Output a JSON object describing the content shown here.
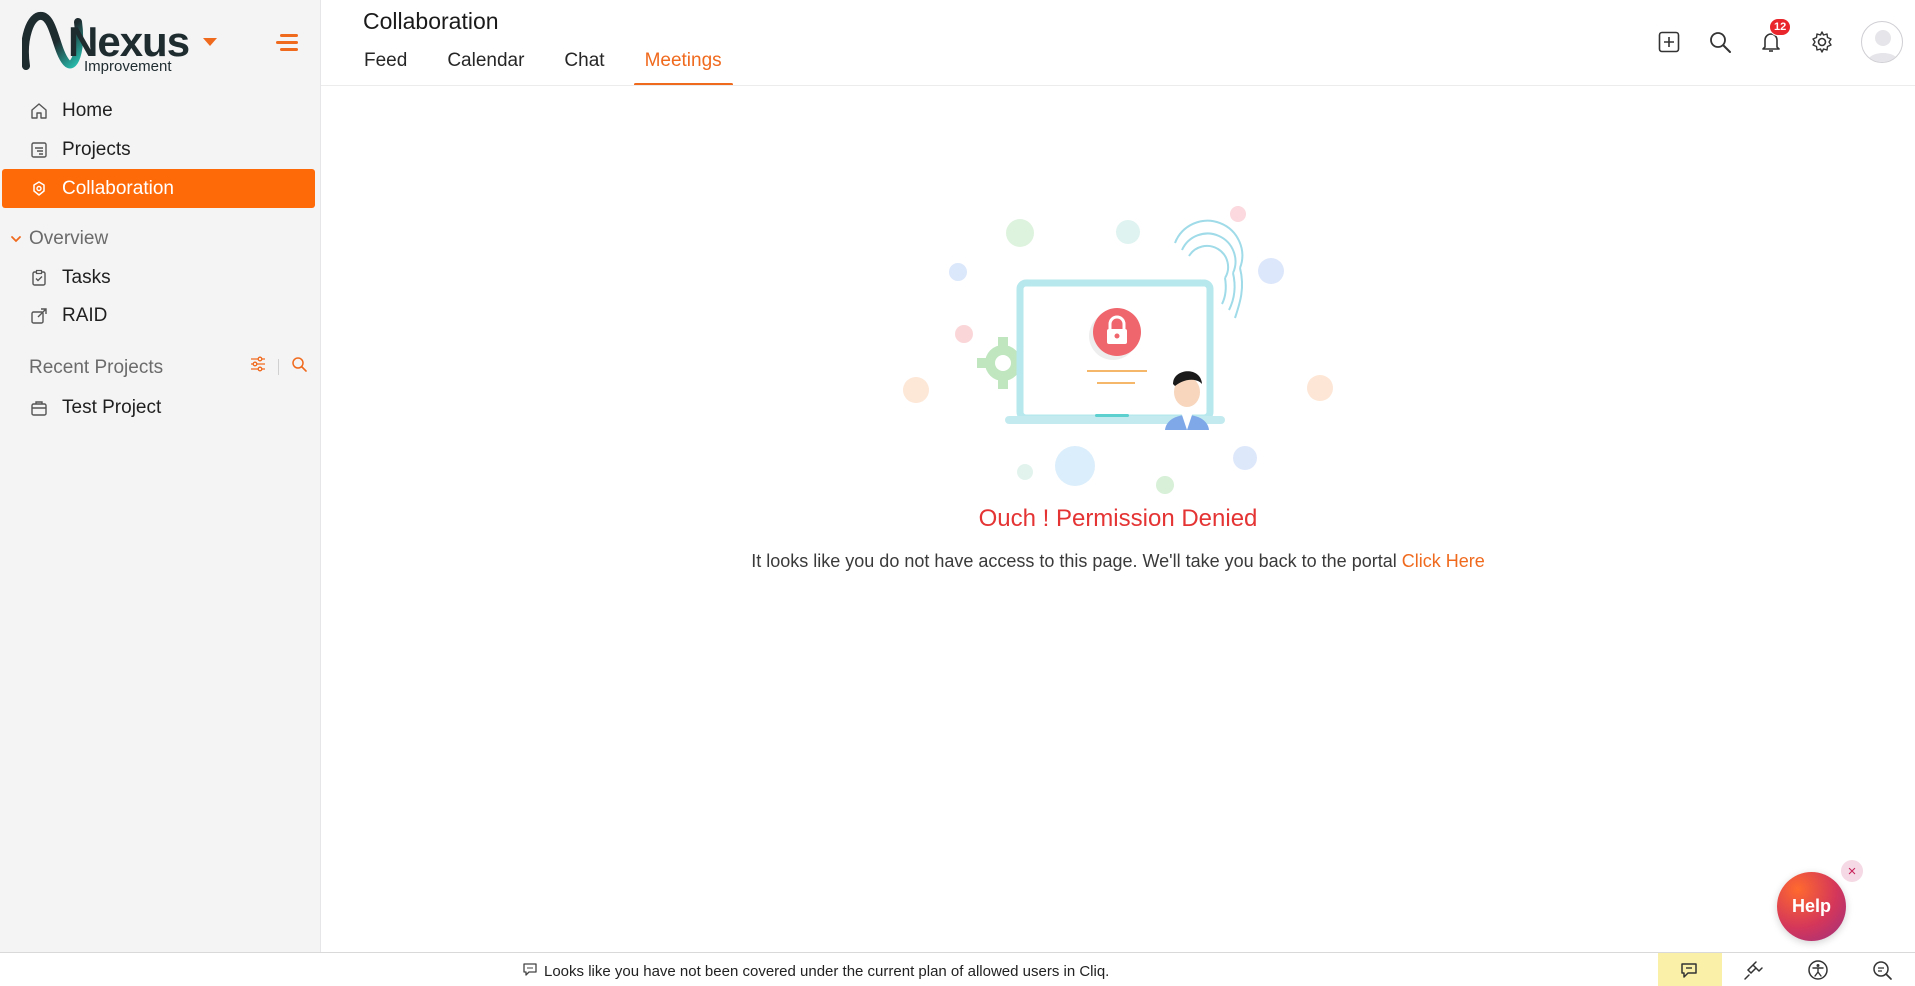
{
  "brand": {
    "name": "Nexus",
    "tagline": "Improvement"
  },
  "sidebar": {
    "items": [
      {
        "label": "Home",
        "icon": "home-icon"
      },
      {
        "label": "Projects",
        "icon": "projects-icon"
      },
      {
        "label": "Collaboration",
        "icon": "collaboration-icon",
        "active": true
      }
    ],
    "overview_label": "Overview",
    "overview_items": [
      {
        "label": "Tasks",
        "icon": "tasks-icon"
      },
      {
        "label": "RAID",
        "icon": "raid-icon"
      }
    ],
    "recent_label": "Recent Projects",
    "recent_items": [
      {
        "label": "Test Project",
        "icon": "briefcase-icon"
      }
    ]
  },
  "header": {
    "title": "Collaboration",
    "tabs": [
      {
        "label": "Feed"
      },
      {
        "label": "Calendar"
      },
      {
        "label": "Chat"
      },
      {
        "label": "Meetings",
        "active": true
      }
    ],
    "notification_count": "12"
  },
  "main": {
    "title": "Ouch ! Permission Denied",
    "message": "It looks like you do not have access to this page. We'll take you back to the portal",
    "link_label": "Click Here"
  },
  "help": {
    "label": "Help",
    "close": "×"
  },
  "bottom_bar": {
    "message": "Looks like you have not been covered under the current plan of allowed users in Cliq."
  },
  "colors": {
    "accent": "#f06a1e",
    "active_nav": "#ff6a08",
    "error": "#e53434",
    "badge": "#e8262b"
  }
}
